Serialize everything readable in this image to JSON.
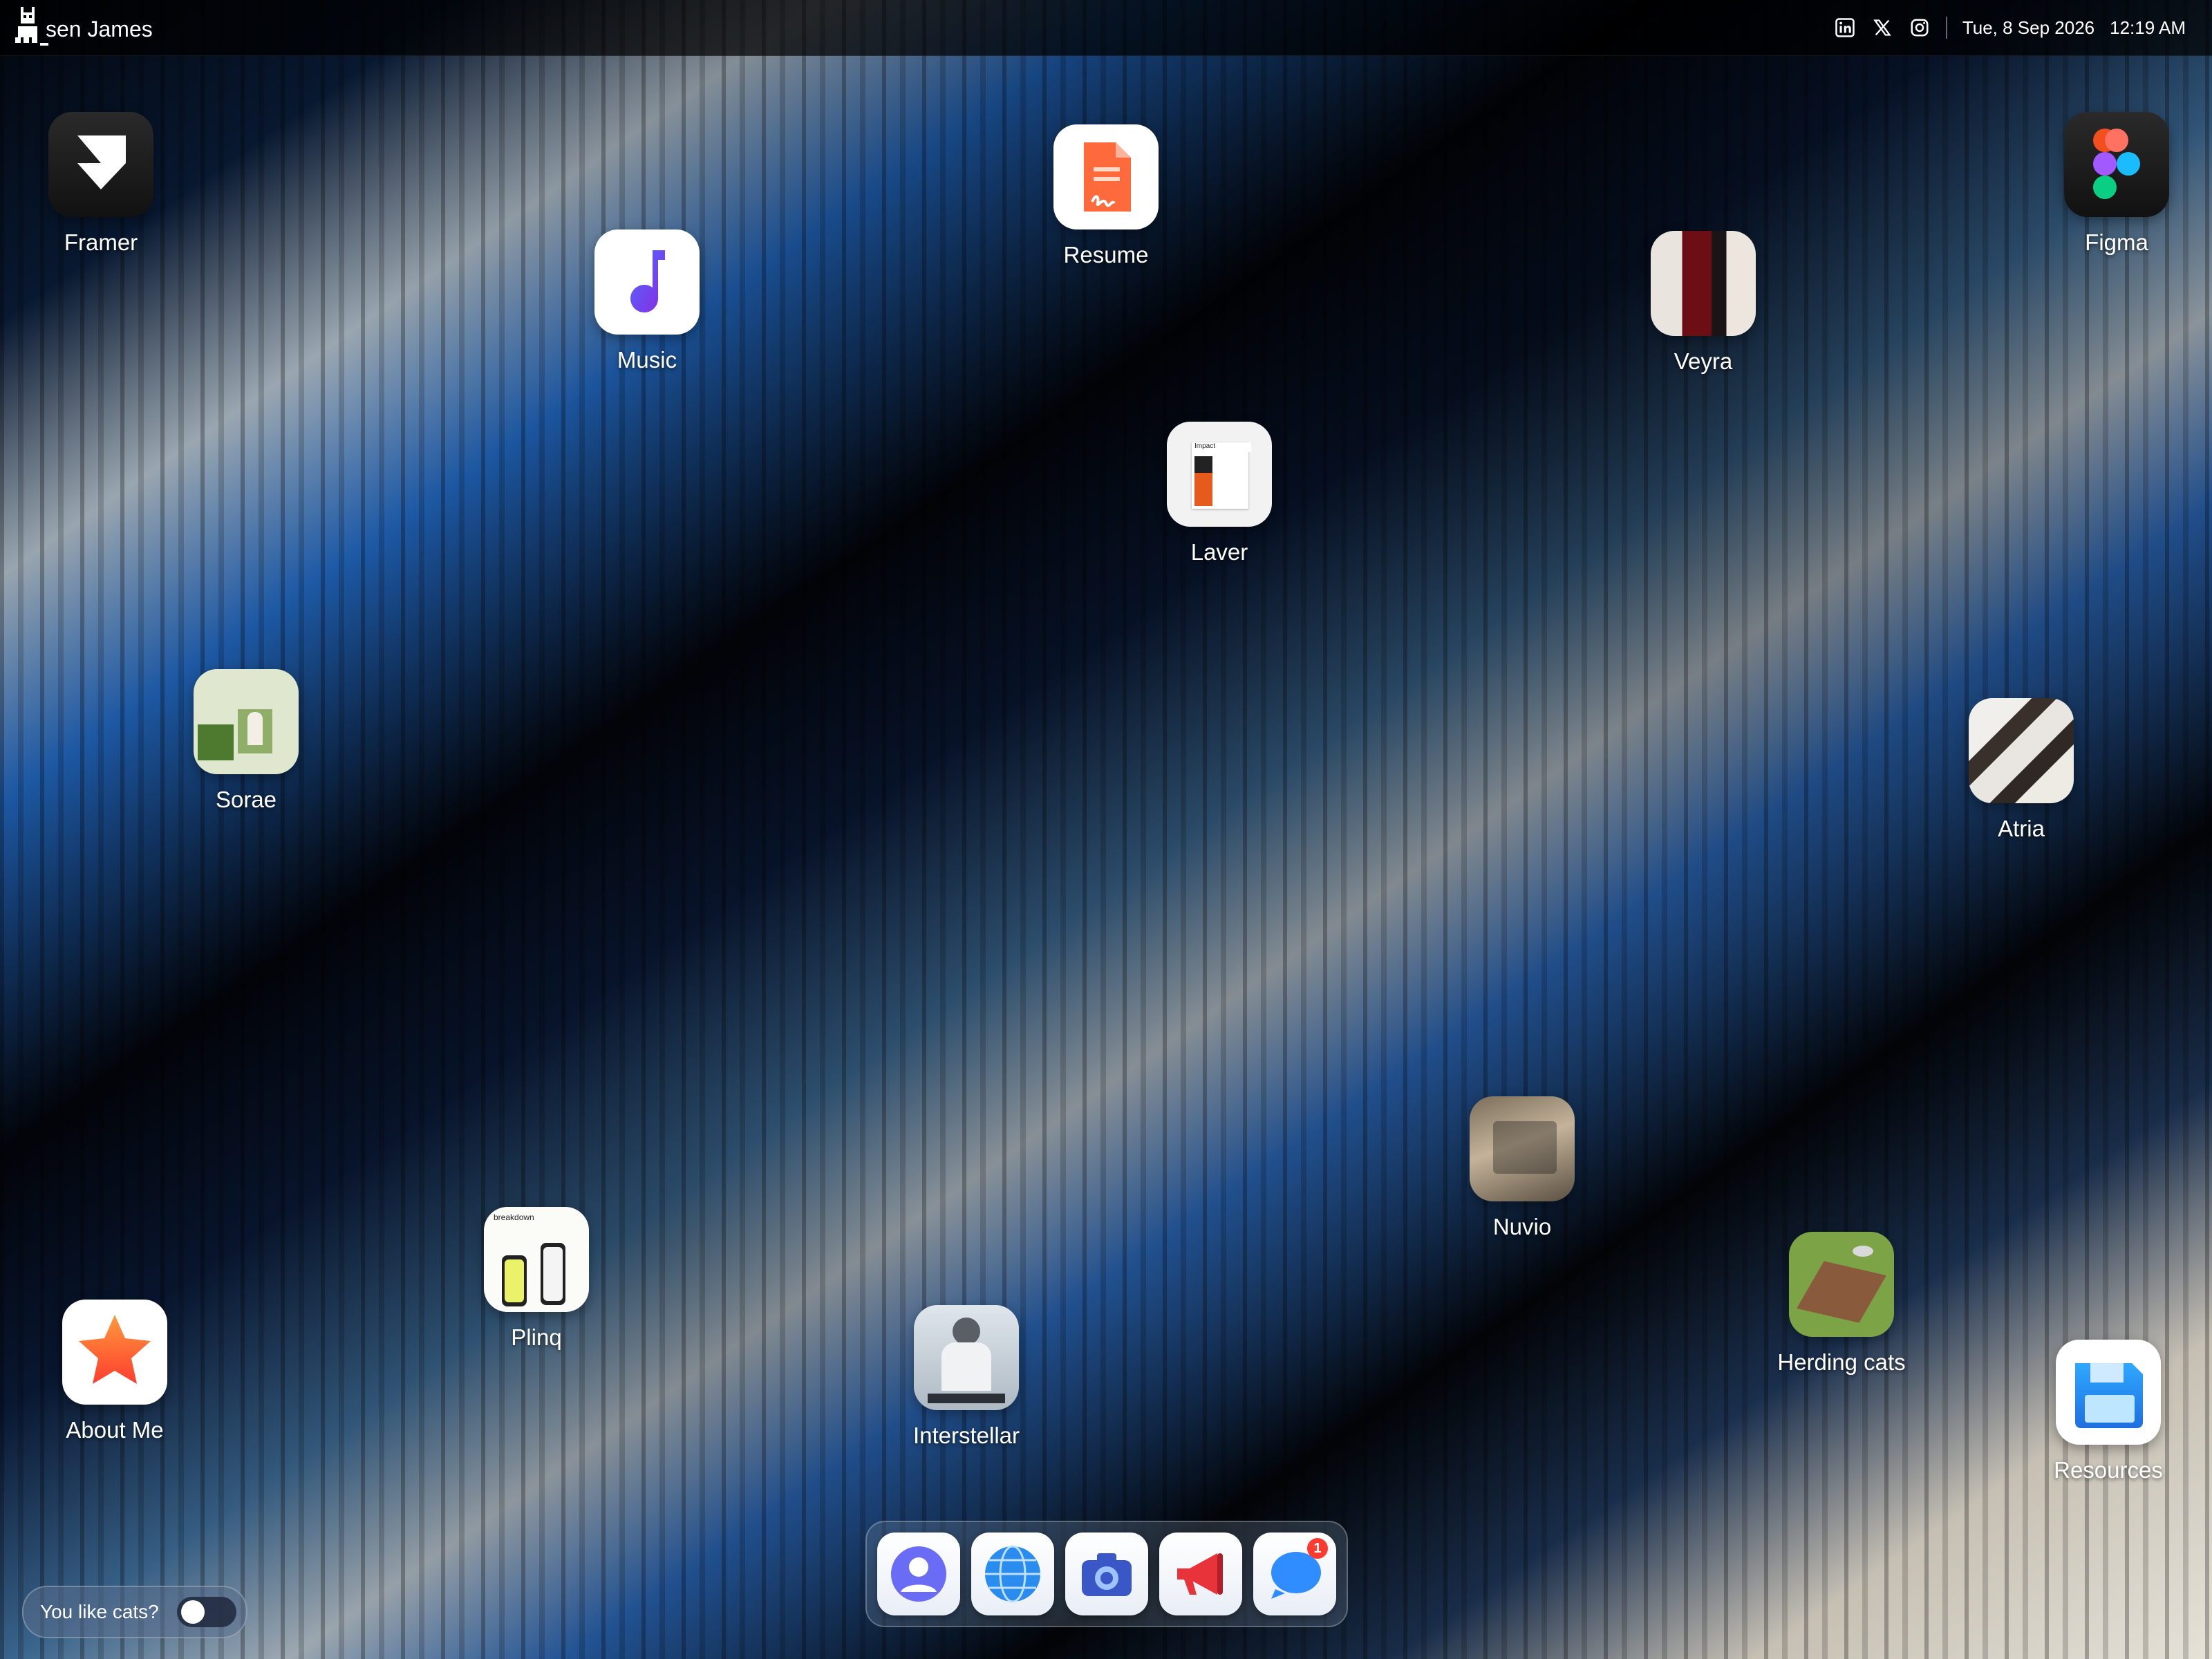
{
  "topbar": {
    "brand_name": "sen James",
    "date": "Tue, 8 Sep 2026",
    "time": "12:19 AM",
    "social_icons": [
      "linkedin-icon",
      "x-icon",
      "instagram-icon"
    ]
  },
  "desktop_icons": [
    {
      "label": "Framer",
      "icon": "framer-logo-icon"
    },
    {
      "label": "Music",
      "icon": "music-note-icon"
    },
    {
      "label": "Resume",
      "icon": "document-icon"
    },
    {
      "label": "Veyra",
      "icon": "veyra-thumbnail"
    },
    {
      "label": "Figma",
      "icon": "figma-logo-icon"
    },
    {
      "label": "Laver",
      "icon": "laver-thumbnail"
    },
    {
      "label": "Sorae",
      "icon": "sorae-thumbnail"
    },
    {
      "label": "Atria",
      "icon": "atria-thumbnail"
    },
    {
      "label": "Nuvio",
      "icon": "nuvio-thumbnail"
    },
    {
      "label": "Plinq",
      "icon": "plinq-thumbnail"
    },
    {
      "label": "Herding cats",
      "icon": "herding-cats-thumbnail"
    },
    {
      "label": "About Me",
      "icon": "star-icon"
    },
    {
      "label": "Interstellar",
      "icon": "interstellar-thumbnail"
    },
    {
      "label": "Resources",
      "icon": "floppy-disk-icon"
    }
  ],
  "thumb_text": {
    "laver": "Impact",
    "plinq": "breakdown"
  },
  "dock": {
    "items": [
      "contacts-icon",
      "globe-icon",
      "camera-icon",
      "megaphone-icon",
      "messages-icon"
    ],
    "messages_badge": "1"
  },
  "cats_toggle": {
    "label": "You like cats?",
    "state": "off"
  },
  "colors": {
    "accent_blue": "#3d8bff",
    "resume_orange": "#ff6a3d",
    "badge_red": "#ff3b30"
  }
}
